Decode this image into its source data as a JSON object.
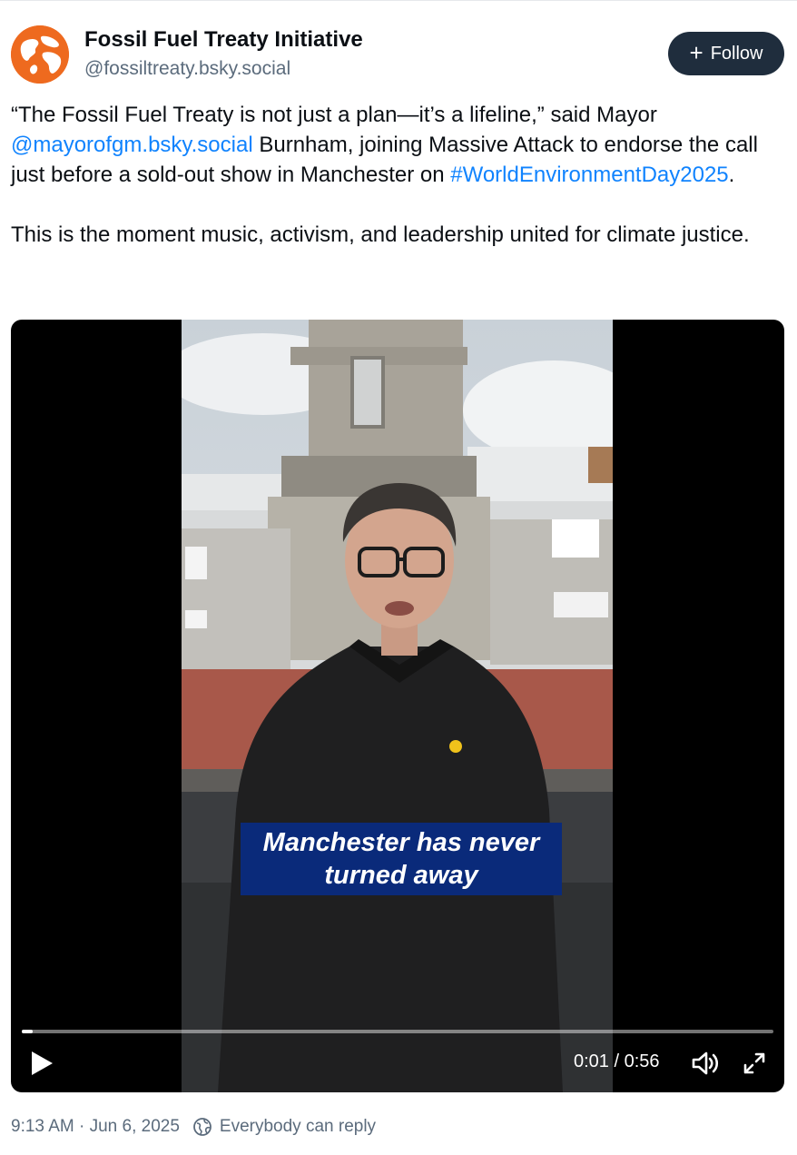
{
  "post": {
    "author_name": "Fossil Fuel Treaty Initiative",
    "author_handle": "@fossiltreaty.bsky.social",
    "follow_label": "Follow",
    "text": {
      "p1_a": "“The Fossil Fuel Treaty is not just a plan—it’s a lifeline,” said Mayor ",
      "mention": "@mayorofgm.bsky.social",
      "p1_b": " Burnham, joining Massive Attack to endorse the call just before a sold-out show in Manchester on ",
      "hashtag": "#WorldEnvironmentDay2025",
      "p1_c": ".",
      "p2": "This is the moment music, activism, and leadership united for climate justice."
    },
    "link_color": "#1083fe"
  },
  "video": {
    "caption_line1": "Manchester has never",
    "caption_line2": "turned away",
    "current_time": "0:01",
    "separator": " / ",
    "duration": "0:56",
    "progress_fraction": 0.014,
    "icons": [
      "play-icon",
      "volume-icon",
      "fullscreen-icon"
    ]
  },
  "meta": {
    "timestamp": "9:13 AM · Jun 6, 2025",
    "reply_setting": "Everybody can reply",
    "reply_icon": "globe-icon"
  },
  "colors": {
    "follow_button": "#1f2d3d",
    "caption_background": "#0a2a7a",
    "avatar": "#ee6a1f"
  }
}
